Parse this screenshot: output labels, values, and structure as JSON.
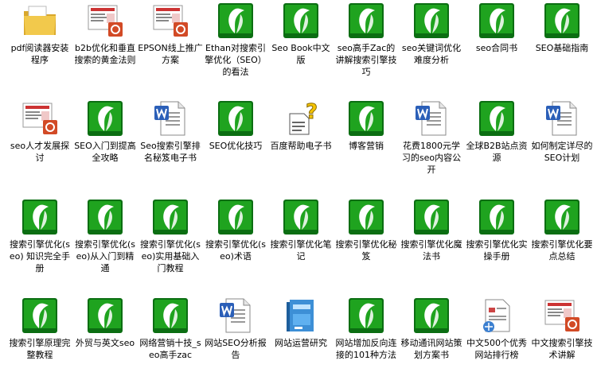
{
  "icon_colors": {
    "chm_green": "#1fa31f",
    "chm_dark": "#0b6e12",
    "chm_leaf": "#ffffff",
    "folder": "#f2c94c",
    "word_blue": "#2b5fb8",
    "help_yellow": "#f5c400"
  },
  "rows": [
    [
      {
        "label": "pdf阅读器安装程序",
        "icon": "folder-icon"
      },
      {
        "label": "b2b优化和垂直搜索的黄金法则",
        "icon": "presentation-icon"
      },
      {
        "label": "EPSON线上推广方案",
        "icon": "presentation-icon"
      },
      {
        "label": "Ethan对搜索引擎优化（SEO）的看法",
        "icon": "chm-icon"
      },
      {
        "label": "Seo Book中文版",
        "icon": "chm-icon"
      },
      {
        "label": "seo高手Zac的讲解搜索引擎技巧",
        "icon": "chm-icon"
      },
      {
        "label": "seo关键词优化难度分析",
        "icon": "chm-icon"
      },
      {
        "label": "seo合同书",
        "icon": "chm-icon"
      },
      {
        "label": "SEO基础指南",
        "icon": "chm-icon"
      }
    ],
    [
      {
        "label": "seo人才发展探讨",
        "icon": "presentation-icon"
      },
      {
        "label": "SEO入门到提高全攻略",
        "icon": "chm-icon"
      },
      {
        "label": "Seo搜索引擎排名秘笈电子书",
        "icon": "word-icon"
      },
      {
        "label": "SEO优化技巧",
        "icon": "chm-icon"
      },
      {
        "label": "百度帮助电子书",
        "icon": "help-icon"
      },
      {
        "label": "博客营销",
        "icon": "chm-icon"
      },
      {
        "label": "花费1800元学习的seo内容公开",
        "icon": "word-icon"
      },
      {
        "label": "全球B2B站点资源",
        "icon": "chm-icon"
      },
      {
        "label": "如何制定详尽的SEO计划",
        "icon": "word-icon"
      }
    ],
    [
      {
        "label": "搜索引擎优化(seo) 知识完全手册",
        "icon": "chm-icon"
      },
      {
        "label": "搜索引擎优化(seo)从入门到精通",
        "icon": "chm-icon"
      },
      {
        "label": "搜索引擎优化(seo)实用基础入门教程",
        "icon": "chm-icon"
      },
      {
        "label": "搜索引擎优化(seo)术语",
        "icon": "chm-icon"
      },
      {
        "label": "搜索引擎优化笔记",
        "icon": "chm-icon"
      },
      {
        "label": "搜索引擎优化秘笈",
        "icon": "chm-icon"
      },
      {
        "label": "搜索引擎优化魔法书",
        "icon": "chm-icon"
      },
      {
        "label": "搜索引擎优化实操手册",
        "icon": "chm-icon"
      },
      {
        "label": "搜索引擎优化要点总结",
        "icon": "chm-icon"
      }
    ],
    [
      {
        "label": "搜索引擎原理完整教程",
        "icon": "chm-icon"
      },
      {
        "label": "外贸与英文seo",
        "icon": "chm-icon"
      },
      {
        "label": "网络营销十技_seo高手zac",
        "icon": "chm-icon"
      },
      {
        "label": "网站SEO分析报告",
        "icon": "word-icon"
      },
      {
        "label": "网站运营研究",
        "icon": "book-icon"
      },
      {
        "label": "网站增加反向连接的101种方法",
        "icon": "chm-icon"
      },
      {
        "label": "移动通讯网站策划方案书",
        "icon": "chm-icon"
      },
      {
        "label": "中文500个优秀网站排行榜",
        "icon": "webpage-icon"
      },
      {
        "label": "中文搜索引擎技术讲解",
        "icon": "presentation-icon"
      }
    ]
  ]
}
